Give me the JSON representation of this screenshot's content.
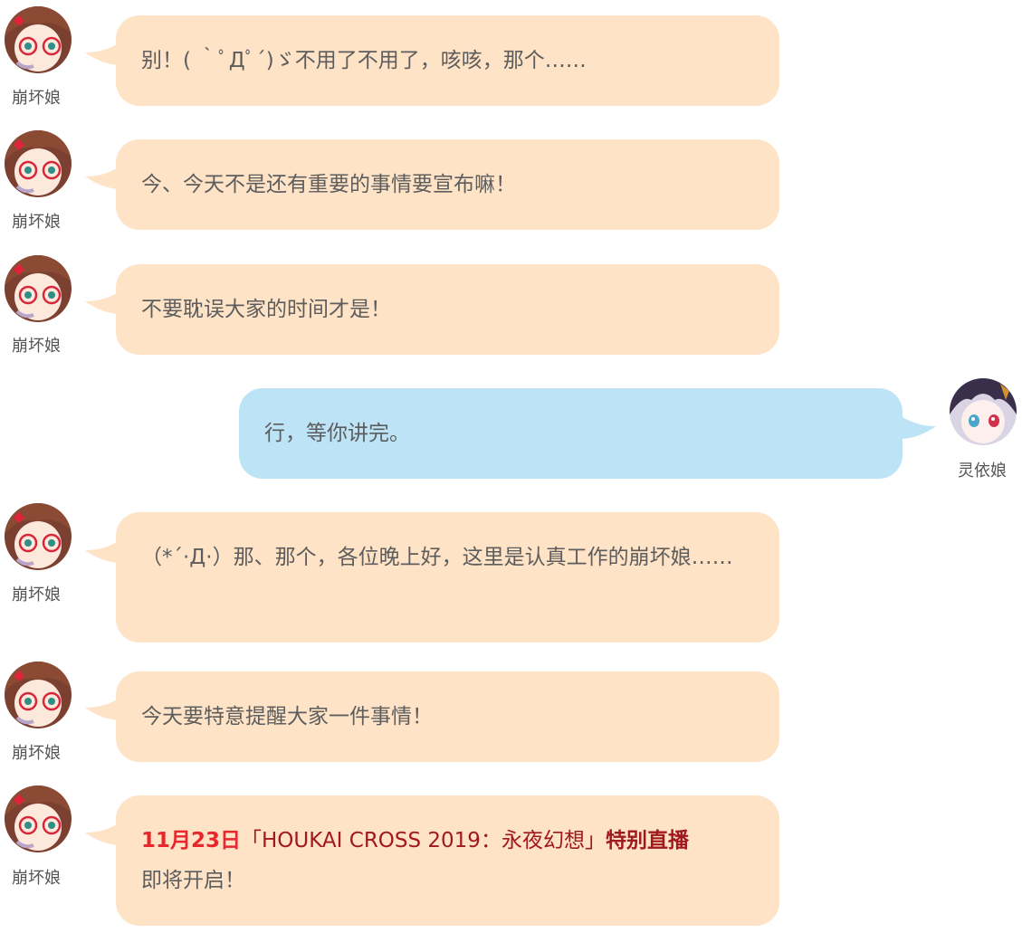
{
  "speakers": {
    "left": "崩坏娘",
    "right": "灵依娘"
  },
  "messages": [
    {
      "text": "别！( ｀ﾟДﾟ´)ゞ不用了不用了，咳咳，那个……"
    },
    {
      "text": "今、今天不是还有重要的事情要宣布嘛！"
    },
    {
      "text": "不要耽误大家的时间才是！"
    },
    {
      "text": "行，等你讲完。"
    },
    {
      "text": "（*´·Д·）那、那个，各位晚上好，这里是认真工作的崩坏娘……"
    },
    {
      "text": "今天要特意提醒大家一件事情！"
    },
    {
      "date": "11月23日",
      "event": "「HOUKAI CROSS 2019：永夜幻想」",
      "highlight": "特别直播",
      "suffix": "即将开启！"
    }
  ],
  "colors": {
    "left_bubble": "#fee3c6",
    "right_bubble": "#bde3f7",
    "date_red": "#e8262c",
    "event_dark_red": "#a1191d"
  },
  "icons": {
    "left_avatar": "houkai-girl-avatar-icon",
    "right_avatar": "lingyi-girl-avatar-icon"
  }
}
